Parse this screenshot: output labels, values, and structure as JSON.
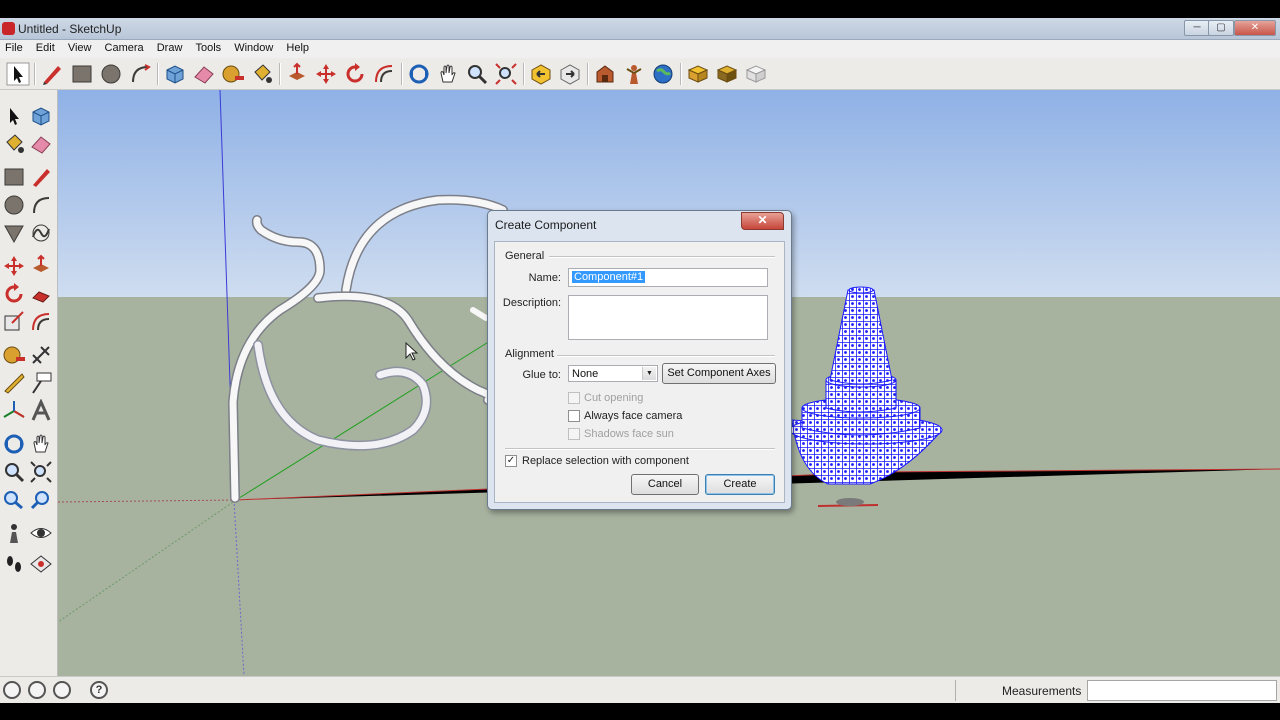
{
  "window": {
    "title": "Untitled - SketchUp",
    "controls": {
      "minimize": "─",
      "maximize": "▢",
      "close": "✕"
    }
  },
  "menubar": {
    "items": [
      "File",
      "Edit",
      "View",
      "Camera",
      "Draw",
      "Tools",
      "Window",
      "Help"
    ]
  },
  "toolbar": {
    "icons": [
      "select-icon",
      "pencil-icon",
      "rectangle-icon",
      "circle-icon",
      "arc-icon",
      "make-component-icon",
      "eraser-icon",
      "tape-measure-icon",
      "paint-bucket-icon",
      "push-pull-icon",
      "move-icon",
      "rotate-icon",
      "offset-icon",
      "orbit-icon",
      "pan-icon",
      "zoom-icon",
      "zoom-extents-icon",
      "previous-icon",
      "next-icon",
      "get-models-icon",
      "share-model-icon",
      "google-earth-icon",
      "get-current-view-icon",
      "toggle-terrain-icon",
      "place-model-icon"
    ]
  },
  "statusbar": {
    "icons": [
      "geo-location-icon",
      "credits-icon",
      "user-icon",
      "help-icon"
    ],
    "measurements_label": "Measurements",
    "measurements_value": ""
  },
  "dialog": {
    "title": "Create Component",
    "close_glyph": "✕",
    "general_label": "General",
    "name_label": "Name:",
    "name_value": "Component#1",
    "description_label": "Description:",
    "description_value": "",
    "alignment_label": "Alignment",
    "glue_label": "Glue to:",
    "glue_value": "None",
    "set_axes_label": "Set Component Axes",
    "cut_opening_label": "Cut opening",
    "always_face_label": "Always face camera",
    "shadows_face_label": "Shadows face sun",
    "replace_label": "Replace selection with component",
    "replace_checked": "✓",
    "cancel_label": "Cancel",
    "create_label": "Create"
  },
  "colors": {
    "sky_top": "#8fb1e6",
    "sky_bottom": "#cfddf0",
    "ground": "#a8b39f",
    "mesh_blue": "#1a1aff",
    "pipe": "#f7f7f7"
  }
}
